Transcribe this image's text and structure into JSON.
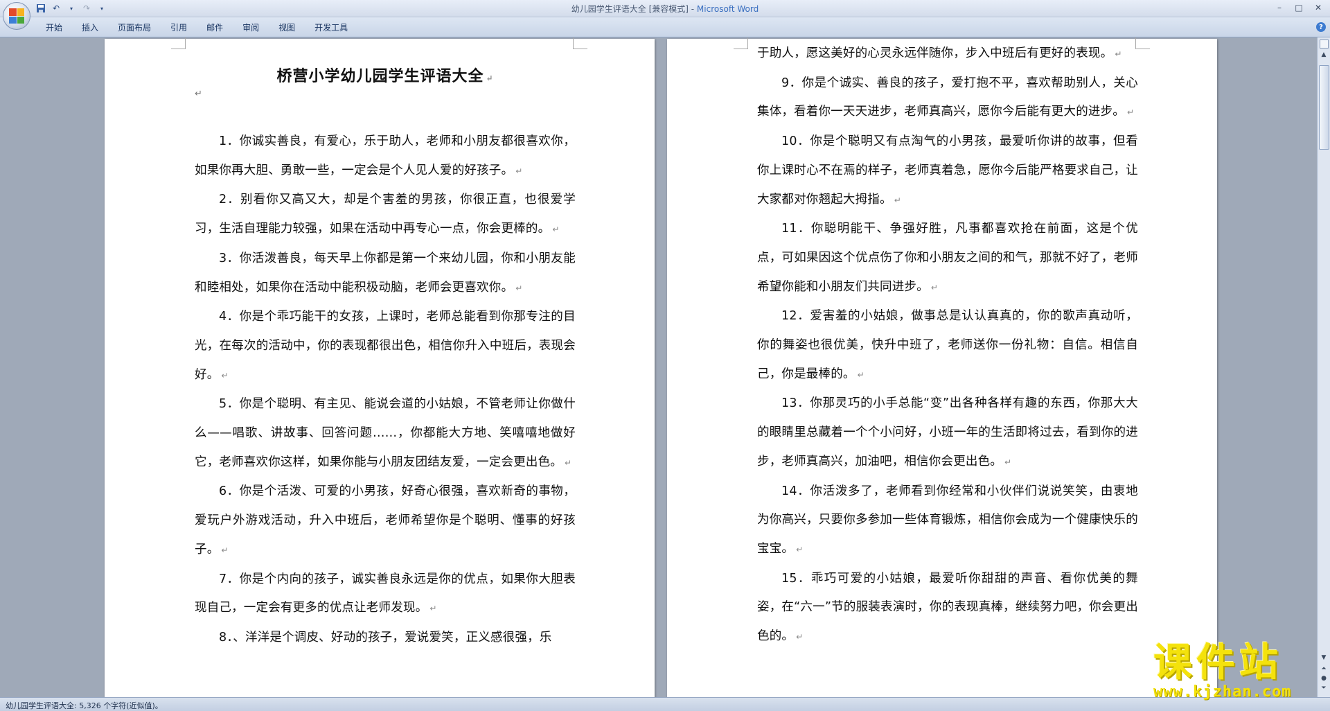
{
  "window": {
    "title_doc": "幼儿园学生评语大全 [兼容模式] - ",
    "title_app": "Microsoft Word",
    "minimize": "–",
    "maximize": "□",
    "close": "✕"
  },
  "quick_access": {
    "save_icon": "save-icon",
    "undo_icon": "undo-icon",
    "redo_icon": "redo-icon",
    "customize_icon": "dropdown-icon"
  },
  "ribbon": {
    "tabs": [
      "开始",
      "插入",
      "页面布局",
      "引用",
      "邮件",
      "审阅",
      "视图",
      "开发工具"
    ],
    "help": "?"
  },
  "document": {
    "title": "桥营小学幼儿园学生评语大全",
    "para_mark": "↵",
    "left_page": [
      {
        "text": "1．你诚实善良，有爱心，乐于助人，老师和小朋友都很喜欢你，如果你再大胆、勇敢一些，一定会是个人见人爱的好孩子。"
      },
      {
        "text": "2．别看你又高又大，却是个害羞的男孩，你很正直，也很爱学习，生活自理能力较强，如果在活动中再专心一点，你会更棒的。"
      },
      {
        "text": "3．你活泼善良，每天早上你都是第一个来幼儿园，你和小朋友能和睦相处，如果你在活动中能积极动脑，老师会更喜欢你。"
      },
      {
        "text": "4．你是个乖巧能干的女孩，上课时，老师总能看到你那专注的目光，在每次的活动中，你的表现都很出色，相信你升入中班后，表现会好。"
      },
      {
        "text": "5．你是个聪明、有主见、能说会道的小姑娘，不管老师让你做什么——唱歌、讲故事、回答问题……，你都能大方地、笑嘻嘻地做好它，老师喜欢你这样，如果你能与小朋友团结友爱，一定会更出色。"
      },
      {
        "text": "6．你是个活泼、可爱的小男孩，好奇心很强，喜欢新奇的事物，爱玩户外游戏活动，升入中班后，老师希望你是个聪明、懂事的好孩子。"
      },
      {
        "text": "7．你是个内向的孩子，诚实善良永远是你的优点，如果你大胆表现自己，一定会有更多的优点让老师发现。"
      },
      {
        "text": "8．、洋洋是个调皮、好动的孩子，爱说爱笑，正义感很强，乐"
      }
    ],
    "right_continuation": "于助人，愿这美好的心灵永远伴随你，步入中班后有更好的表现。",
    "right_page": [
      {
        "text": "9．你是个诚实、善良的孩子，爱打抱不平，喜欢帮助别人，关心集体，看着你一天天进步，老师真高兴，愿你今后能有更大的进步。"
      },
      {
        "text": "10．你是个聪明又有点淘气的小男孩，最爱听你讲的故事，但看你上课时心不在焉的样子，老师真着急，愿你今后能严格要求自己，让大家都对你翘起大拇指。"
      },
      {
        "text": "11．你聪明能干、争强好胜，凡事都喜欢抢在前面，这是个优点，可如果因这个优点伤了你和小朋友之间的和气，那就不好了，老师希望你能和小朋友们共同进步。"
      },
      {
        "text": "12．爱害羞的小姑娘，做事总是认认真真的，你的歌声真动听，你的舞姿也很优美，快升中班了，老师送你一份礼物：自信。相信自己，你是最棒的。"
      },
      {
        "text": "13．你那灵巧的小手总能“变”出各种各样有趣的东西，你那大大的眼睛里总藏着一个个小问好，小班一年的生活即将过去，看到你的进步，老师真高兴，加油吧，相信你会更出色。"
      },
      {
        "text": "14．你活泼多了，老师看到你经常和小伙伴们说说笑笑，由衷地为你高兴，只要你多参加一些体育锻炼，相信你会成为一个健康快乐的宝宝。"
      },
      {
        "text": "15．乖巧可爱的小姑娘，最爱听你甜甜的声音、看你优美的舞姿，在“六一”节的服装表演时，你的表现真棒，继续努力吧，你会更出色的。"
      }
    ]
  },
  "status_bar": {
    "text": "幼儿园学生评语大全: 5,326 个字符(近似值)。"
  },
  "watermark": {
    "main": "课件站",
    "url": "www.kjzhan.com"
  },
  "colors": {
    "workspace": "#9fa9b8",
    "accent": "#3a6fc0",
    "watermark": "#f4e20c"
  }
}
